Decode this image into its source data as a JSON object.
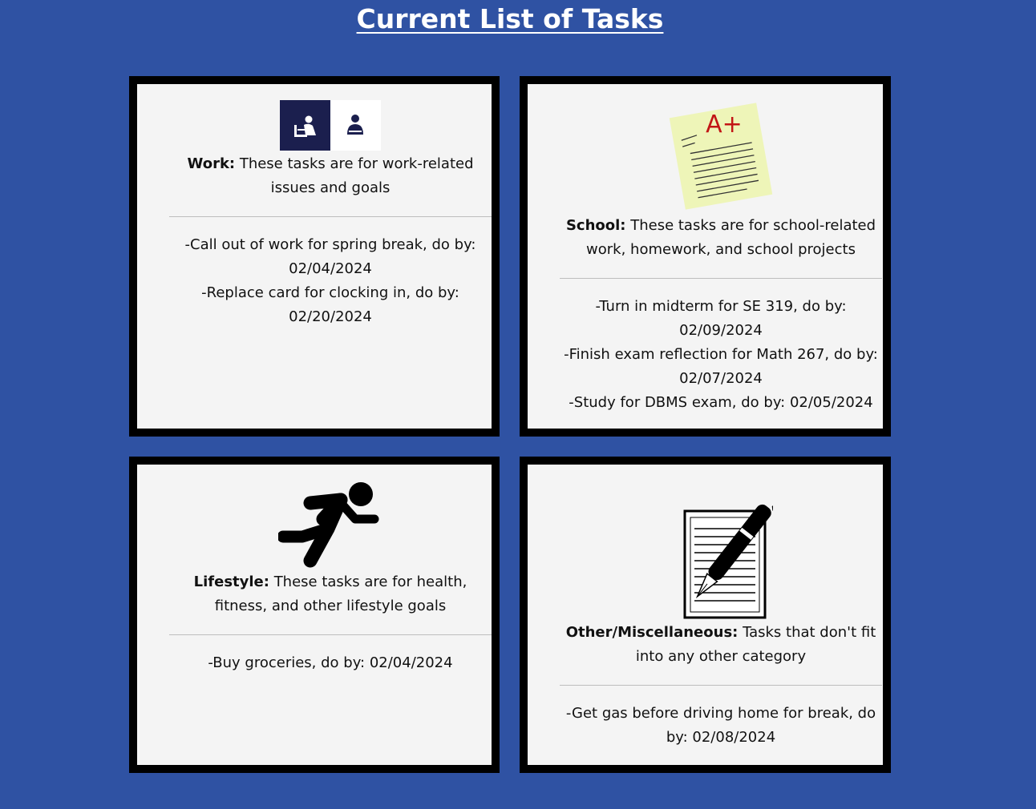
{
  "page": {
    "title": "Current List of Tasks"
  },
  "categories": [
    {
      "id": "work",
      "icon": "office-worker-icons",
      "name": "Work:",
      "description": " These tasks are for work-related issues and goals",
      "tasks": [
        "-Call out of work for spring break, do by: 02/04/2024",
        "-Replace card for clocking in, do by: 02/20/2024"
      ]
    },
    {
      "id": "school",
      "icon": "graded-paper-a-plus-icon",
      "name": "School:",
      "description": " These tasks are for school-related work, homework, and school projects",
      "tasks": [
        "-Turn in midterm for SE 319, do by: 02/09/2024",
        "-Finish exam reflection for Math 267, do by: 02/07/2024",
        "-Study for DBMS exam, do by: 02/05/2024"
      ]
    },
    {
      "id": "lifestyle",
      "icon": "running-person-icon",
      "name": "Lifestyle:",
      "description": " These tasks are for health, fitness, and other lifestyle goals",
      "tasks": [
        "-Buy groceries, do by: 02/04/2024"
      ]
    },
    {
      "id": "other",
      "icon": "paper-and-pen-icon",
      "name": "Other/Miscellaneous:",
      "description": " Tasks that don't fit into any other category",
      "tasks": [
        "-Get gas before driving home for break, do by: 02/08/2024"
      ]
    }
  ],
  "icon_text": {
    "grade": "A+"
  },
  "colors": {
    "background": "#2f52a3",
    "card": "#f4f4f4",
    "border": "#000000",
    "icon_navy": "#1b1f4e",
    "grade_red": "#c21515",
    "paper_yellow": "#eef5b8"
  }
}
